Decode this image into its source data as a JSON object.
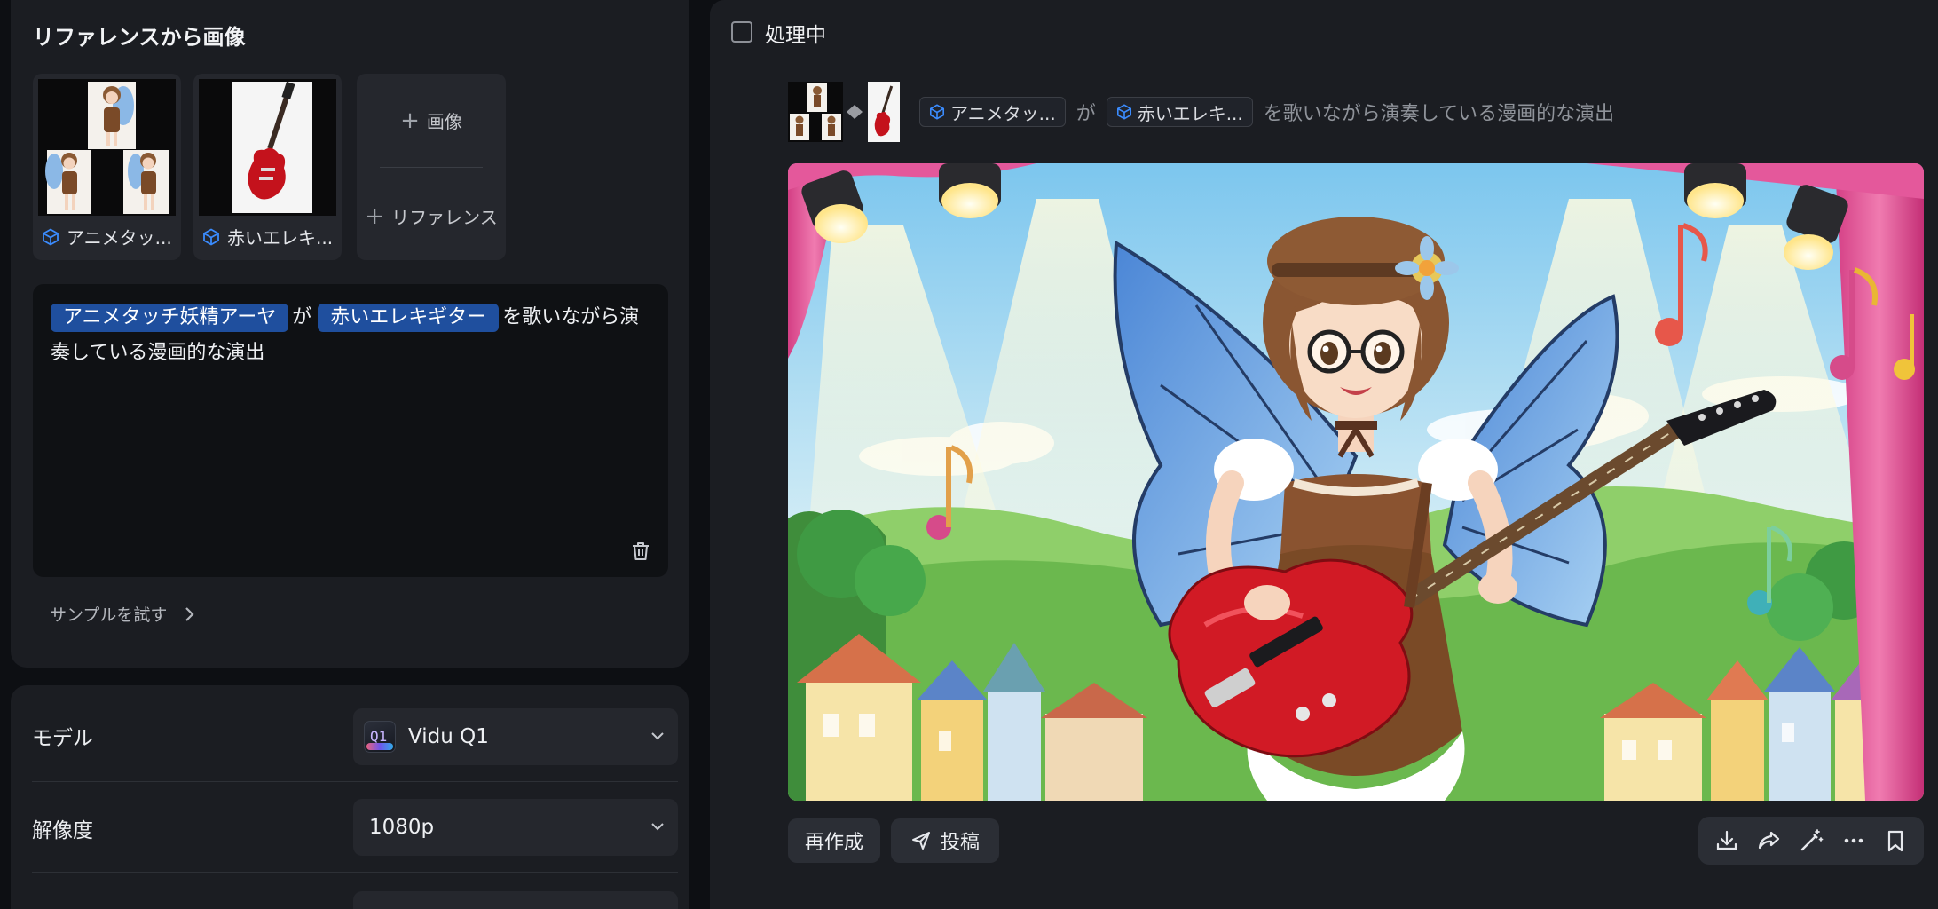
{
  "left": {
    "section_title": "リファレンスから画像",
    "references": [
      {
        "label": "アニメタッ...",
        "icon": "cube-icon"
      },
      {
        "label": "赤いエレキ...",
        "icon": "cube-icon"
      }
    ],
    "add_image_label": "画像",
    "add_reference_label": "リファレンス",
    "prompt": {
      "chip_1": "アニメタッチ妖精アーヤ",
      "joiner": "が",
      "chip_2": "赤いエレキギター",
      "rest": "を歌いながら演奏している漫画的な演出"
    },
    "sample_label": "サンプルを試す"
  },
  "settings": {
    "model_label": "モデル",
    "model_value": "Vidu Q1",
    "model_icon_text": "Q1",
    "resolution_label": "解像度",
    "resolution_value": "1080p"
  },
  "right": {
    "processing_label": "処理中",
    "prompt_line": {
      "chip_1": "アニメタッ...",
      "joiner": "が",
      "chip_2": "赤いエレキ...",
      "rest": "を歌いながら演奏している漫画的な演出"
    },
    "recreate_label": "再作成",
    "post_label": "投稿",
    "toolbar_icons": [
      "download-icon",
      "share-icon",
      "magic-wand-icon",
      "more-icon",
      "bookmark-icon"
    ]
  },
  "colors": {
    "background": "#0d0f13",
    "panel": "#1b1d22",
    "chip_blue": "#1f4f9e",
    "accent_blue": "#3b8cff"
  }
}
